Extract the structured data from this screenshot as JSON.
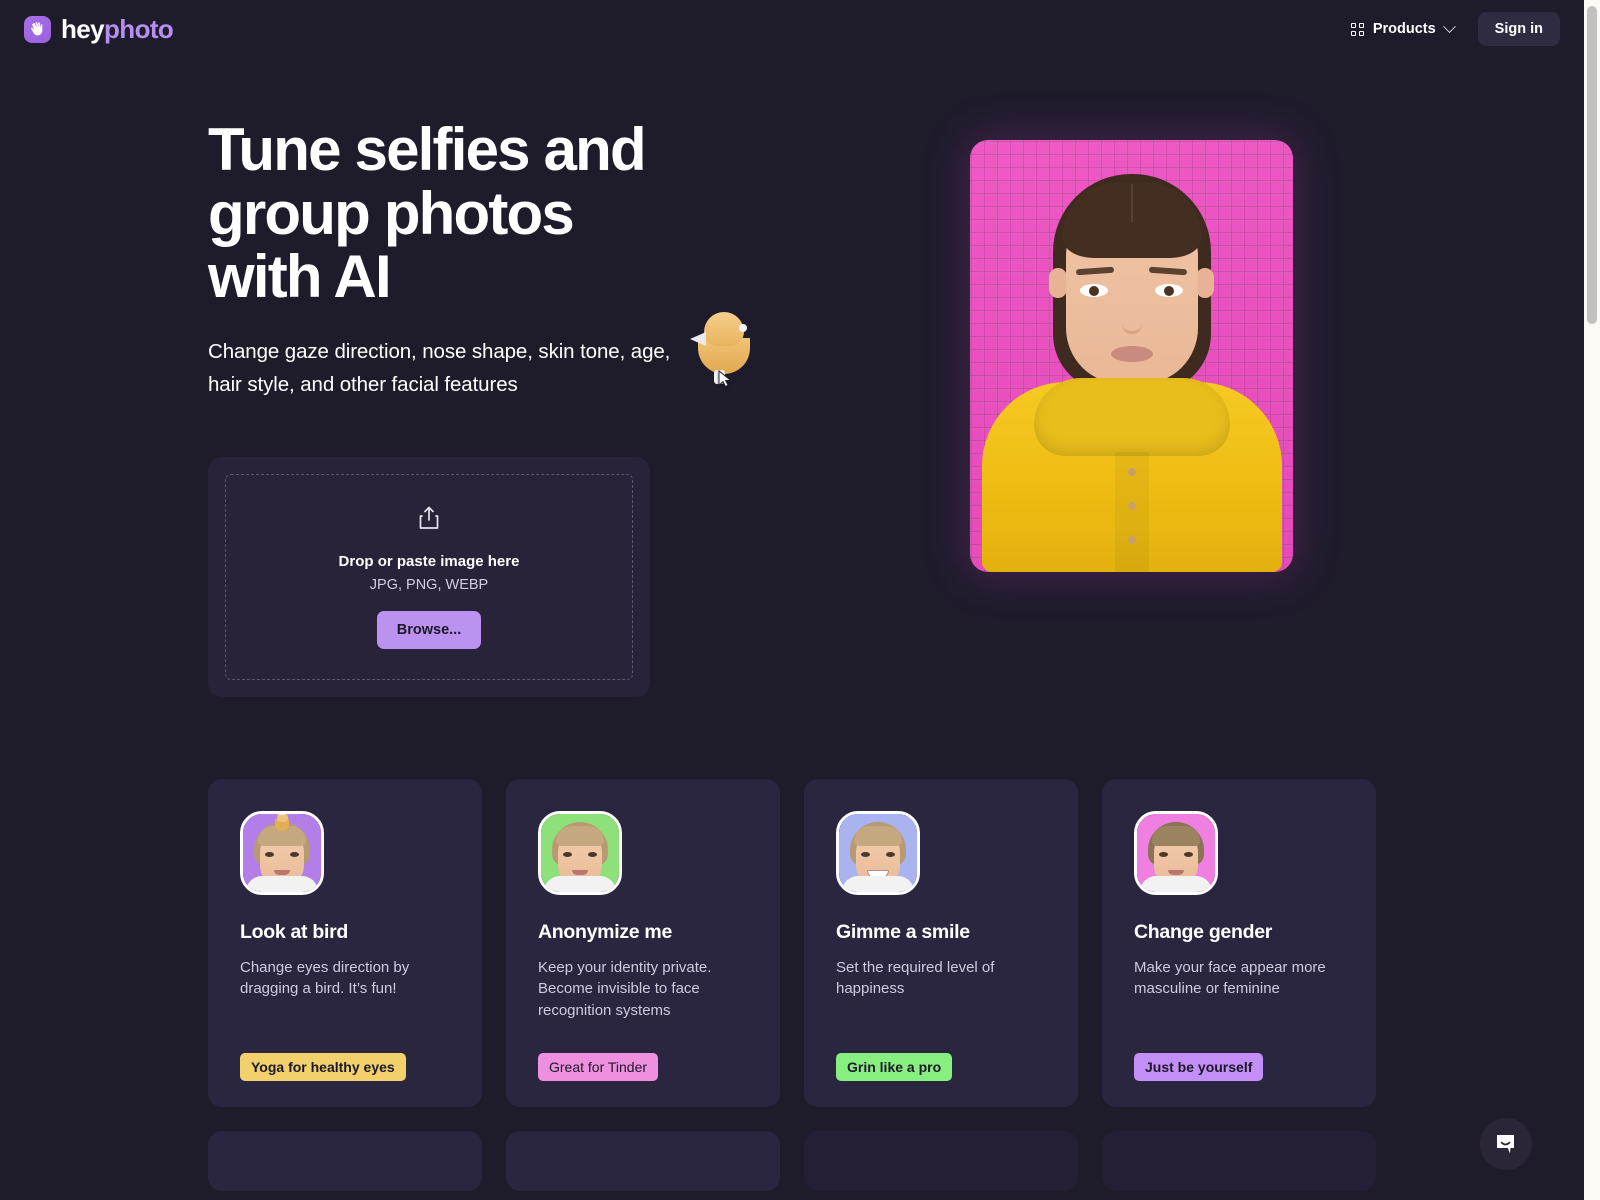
{
  "header": {
    "brand": {
      "hey": "hey",
      "photo": "photo",
      "icon": "waving-hand-icon"
    },
    "products_label": "Products",
    "products_icon": "grid-icon",
    "chevron_icon": "chevron-down-icon",
    "signin_label": "Sign in"
  },
  "hero": {
    "title": "Tune selfies and group photos with AI",
    "subtitle": "Change gaze direction, nose shape, skin tone, age, hair style, and other facial features",
    "upload": {
      "icon": "upload-share-icon",
      "drop_title": "Drop or paste image here",
      "formats": "JPG, PNG, WEBP",
      "browse_label": "Browse..."
    },
    "preview": {
      "bird_icon": "draggable-bird-icon",
      "cursor_icon": "cursor-arrow-icon",
      "photo_alt": "woman in yellow raincoat on pink grid background"
    }
  },
  "features": [
    {
      "title": "Look at bird",
      "description": "Change eyes direction by dragging a bird. It’s fun!",
      "tag": "Yoga for healthy eyes",
      "tag_color": "#f2d06b",
      "thumb_color": "#b37ee8",
      "thumb_variant": "bird",
      "tag_weight": "bold"
    },
    {
      "title": "Anonymize me",
      "description": "Keep your identity private. Become invisible to face recognition systems",
      "tag": "Great for Tinder",
      "tag_color": "#ef8fe0",
      "thumb_color": "#8ee07a",
      "thumb_variant": "plain",
      "tag_weight": "regular"
    },
    {
      "title": "Gimme a smile",
      "description": "Set the required level of happiness",
      "tag": "Grin like a pro",
      "tag_color": "#86ef7f",
      "thumb_color": "#a9b3ef",
      "thumb_variant": "smile",
      "tag_weight": "bold"
    },
    {
      "title": "Change gender",
      "description": "Make your face appear more masculine or feminine",
      "tag": "Just be yourself",
      "tag_color": "#c38ef5",
      "thumb_color": "#ef7fe0",
      "thumb_variant": "male",
      "tag_weight": "bold"
    }
  ],
  "chat": {
    "icon": "chat-smile-icon",
    "label": "Open chat"
  },
  "colors": {
    "page_background": "#1e1b2b",
    "card_background": "#2b2640",
    "upload_card_background": "#282338",
    "accent_purple": "#bb92f0",
    "brand_purple": "#b68ef0",
    "signin_background": "#2f2b40"
  }
}
